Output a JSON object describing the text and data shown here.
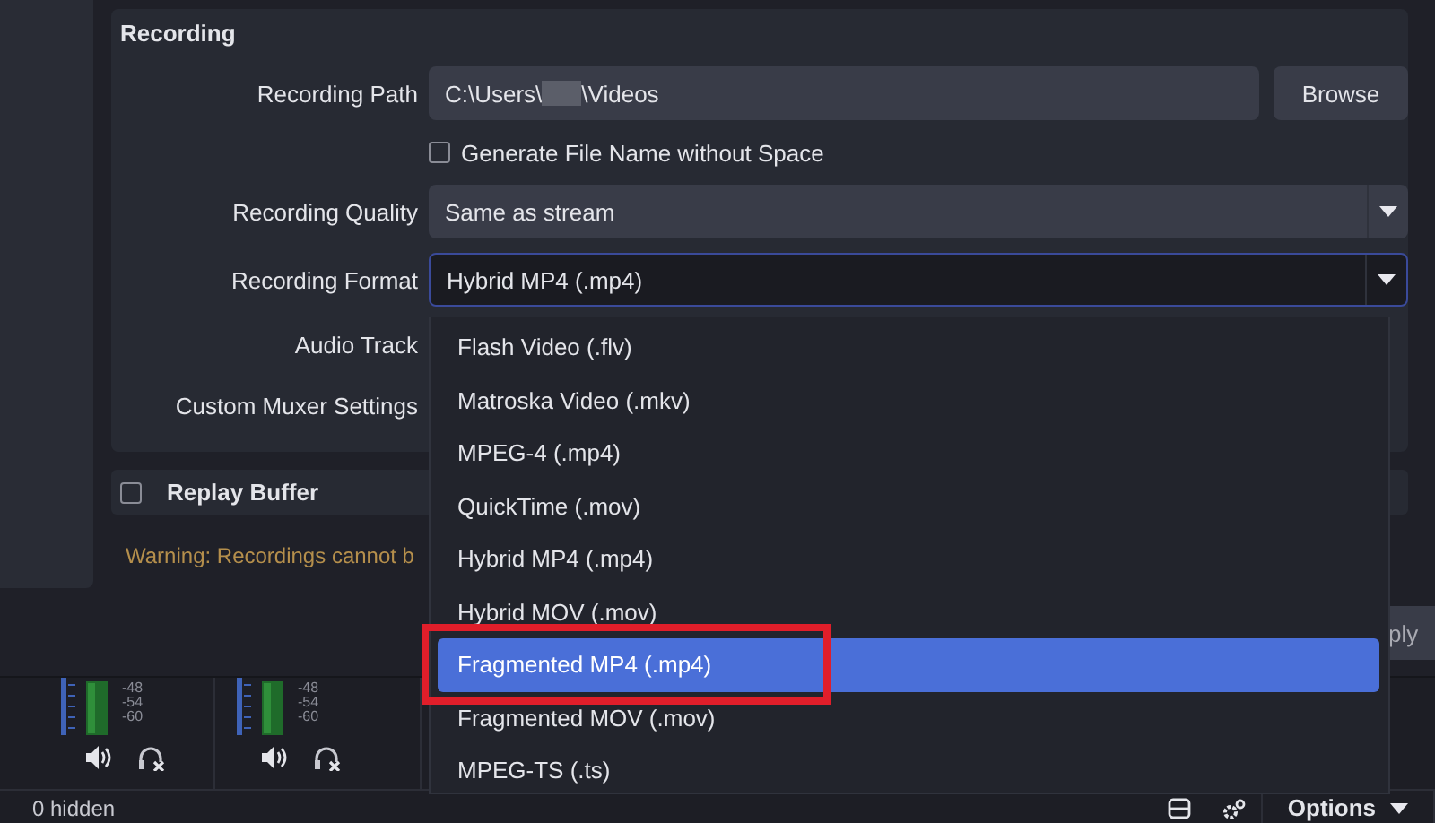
{
  "settings": {
    "section_title": "Recording",
    "recording_path": {
      "label": "Recording Path",
      "value_start": "C:\\Users\\",
      "value_end": "\\Videos",
      "redacted": true,
      "button": "Browse"
    },
    "filename_checkbox": {
      "label": "Generate File Name without Space",
      "checked": false
    },
    "quality": {
      "label": "Recording Quality",
      "value": "Same as stream"
    },
    "format": {
      "label": "Recording Format",
      "value": "Hybrid MP4 (.mp4)",
      "expanded": true
    },
    "audio_track": {
      "label": "Audio Track"
    },
    "custom_muxer": {
      "label": "Custom Muxer Settings"
    },
    "replay_buffer": {
      "label": "Replay Buffer",
      "checked": false
    },
    "warning": "Warning: Recordings cannot b",
    "apply_button": "ply"
  },
  "format_menu": [
    {
      "label": "Flash Video (.flv)",
      "selected": false
    },
    {
      "label": "Matroska Video (.mkv)",
      "selected": false
    },
    {
      "label": "MPEG-4 (.mp4)",
      "selected": false
    },
    {
      "label": "QuickTime (.mov)",
      "selected": false
    },
    {
      "label": "Hybrid MP4 (.mp4)",
      "selected": false
    },
    {
      "label": "Hybrid MOV (.mov)",
      "selected": false
    },
    {
      "label": "Fragmented MP4 (.mp4)",
      "selected": true
    },
    {
      "label": "Fragmented MOV (.mov)",
      "selected": false
    },
    {
      "label": "MPEG-TS (.ts)",
      "selected": false
    }
  ],
  "mixer": {
    "channels": [
      {
        "scale": [
          "-48",
          "-54",
          "-60"
        ]
      },
      {
        "scale": [
          "-48",
          "-54",
          "-60"
        ]
      }
    ],
    "hidden_count": "0 hidden",
    "options_button": "Options"
  }
}
